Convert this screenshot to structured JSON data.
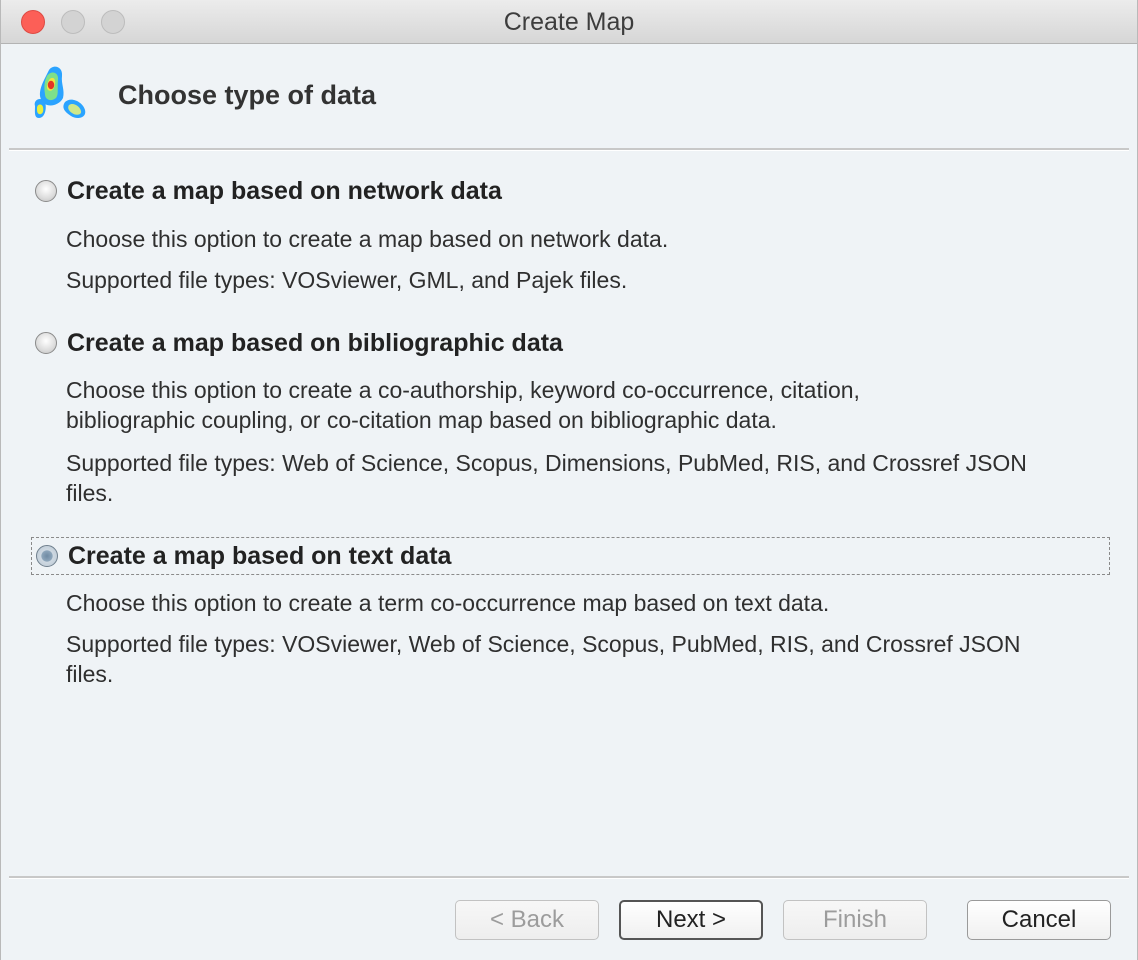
{
  "window": {
    "title": "Create Map"
  },
  "header": {
    "title": "Choose type of data",
    "logo_icon": "vosviewer-logo-icon"
  },
  "options": [
    {
      "label": "Create a map based on network data",
      "selected": false,
      "descriptions": [
        "Choose this option to create a map based on network data.",
        "Supported file types: VOSviewer, GML, and Pajek files."
      ]
    },
    {
      "label": "Create a map based on bibliographic data",
      "selected": false,
      "descriptions": [
        "Choose this option to create a co-authorship, keyword co-occurrence, citation, bibliographic coupling, or co-citation map based on bibliographic data.",
        "Supported file types: Web of Science, Scopus, Dimensions, PubMed, RIS, and Crossref JSON files."
      ]
    },
    {
      "label": "Create a map based on text data",
      "selected": true,
      "descriptions": [
        "Choose this option to create a term co-occurrence map based on text data.",
        "Supported file types: VOSviewer, Web of Science, Scopus, PubMed, RIS, and Crossref JSON files."
      ]
    }
  ],
  "buttons": {
    "back": "< Back",
    "next": "Next >",
    "finish": "Finish",
    "cancel": "Cancel"
  },
  "colors": {
    "close": "#fc5f57",
    "window_bg": "#eff3f6"
  }
}
